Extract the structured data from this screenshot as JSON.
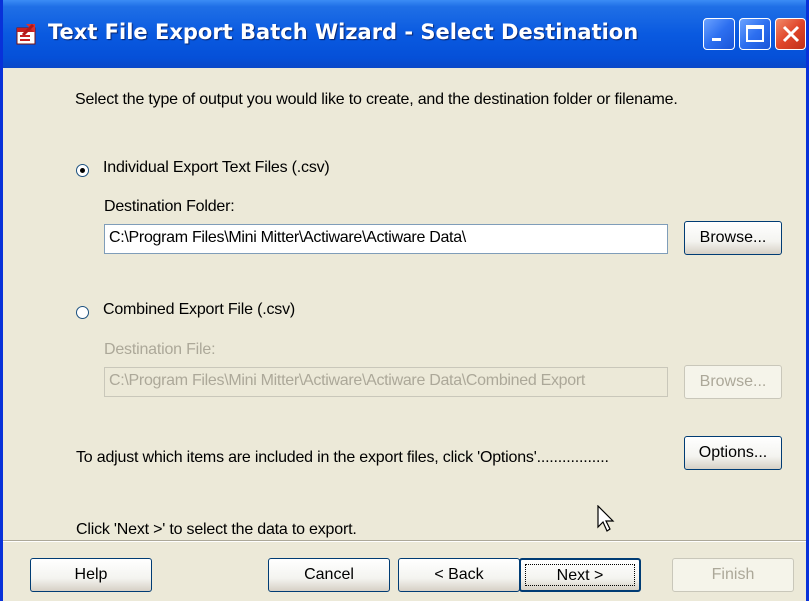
{
  "window": {
    "title": "Text File Export Batch Wizard - Select Destination",
    "app_icon": "export-wizard-icon",
    "controls": [
      "minimize-icon",
      "maximize-icon",
      "close-icon"
    ]
  },
  "intro": "Select the type of output you would like to create, and the destination folder or filename.",
  "options": {
    "individual": {
      "label": "Individual Export Text Files (.csv)",
      "selected": true,
      "field_label": "Destination Folder:",
      "field_value": "C:\\Program Files\\Mini Mitter\\Actiware\\Actiware Data\\",
      "browse_label": "Browse..."
    },
    "combined": {
      "label": "Combined Export File (.csv)",
      "selected": false,
      "field_label": "Destination File:",
      "field_value": "C:\\Program Files\\Mini Mitter\\Actiware\\Actiware Data\\Combined Export",
      "browse_label": "Browse..."
    }
  },
  "options_hint": "To adjust which items are included in the export files, click 'Options'.................",
  "options_button": "Options...",
  "footer_hint": "Click 'Next >' to select the data to export.",
  "buttons": {
    "help": "Help",
    "cancel": "Cancel",
    "back": "< Back",
    "next": "Next >",
    "finish": "Finish"
  },
  "colors": {
    "titlebar": "#0a5ae0",
    "dialog_bg": "#ece9d8",
    "disabled_text": "#aca899",
    "close_button": "#e0462a"
  }
}
